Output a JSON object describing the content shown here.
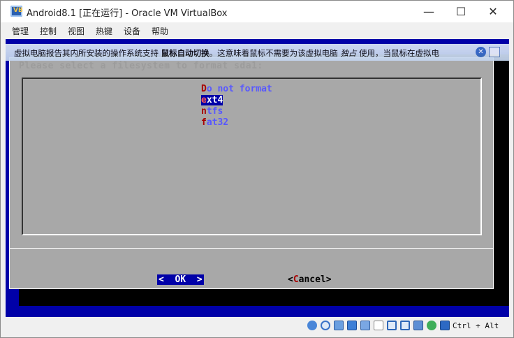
{
  "window": {
    "title": "Android8.1 [正在运行] - Oracle VM VirtualBox",
    "min_glyph": "—",
    "max_glyph": "☐",
    "close_glyph": "✕"
  },
  "menu": [
    {
      "label": "管理"
    },
    {
      "label": "控制"
    },
    {
      "label": "视图"
    },
    {
      "label": "热键"
    },
    {
      "label": "设备"
    },
    {
      "label": "帮助"
    }
  ],
  "notice": {
    "text_before": "虚拟电脑报告其内所安装的操作系统支持 ",
    "text_bold": "鼠标自动切换",
    "text_after": "。这意味着鼠标不需要为该虚拟电脑 ",
    "text_italic": "独占",
    "text_end": " 使用，当鼠标在虚拟电",
    "close_glyph": "✕"
  },
  "vm_dialog": {
    "prompt": "Please select a filesystem to format sda1:",
    "options": [
      {
        "hot": "D",
        "rest": "o not format",
        "selected": false
      },
      {
        "hot": "e",
        "rest": "xt4",
        "selected": true
      },
      {
        "hot": "n",
        "rest": "tfs",
        "selected": false
      },
      {
        "hot": "f",
        "rest": "at32",
        "selected": false
      }
    ],
    "ok_button": "<  OK  >",
    "cancel_open": "<",
    "cancel_hot": "C",
    "cancel_rest": "ancel>"
  },
  "statusbar": {
    "host_key": "Ctrl + Alt"
  },
  "colors": {
    "vm_background": "#0000a8",
    "dialog_gray": "#a8a8a8",
    "hotkey_red": "#a80000",
    "option_blue": "#5858ff"
  }
}
